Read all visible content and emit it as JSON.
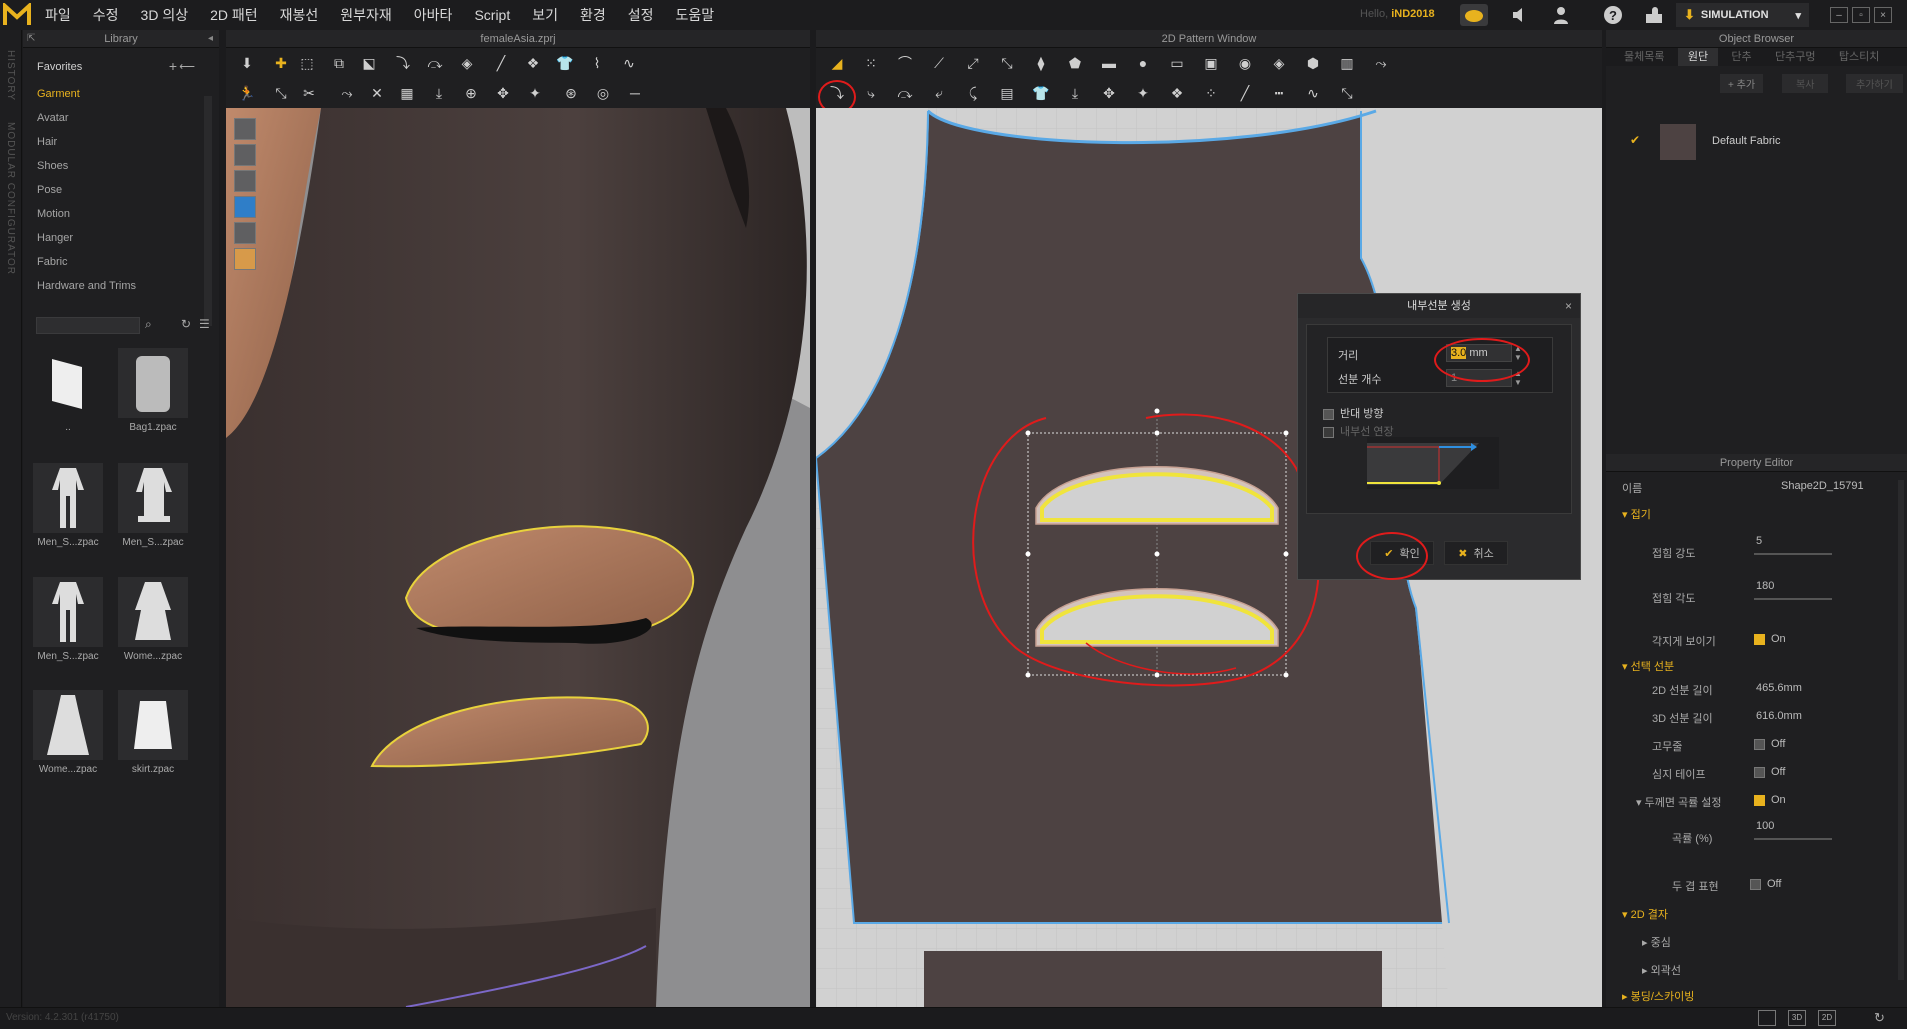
{
  "menu": {
    "items": [
      "파일",
      "수정",
      "3D 의상",
      "2D 패턴",
      "재봉선",
      "원부자재",
      "아바타",
      "Script",
      "보기",
      "환경",
      "설정",
      "도움말"
    ],
    "hello_prefix": "Hello,",
    "user": "iND2018",
    "simulation_label": "SIMULATION",
    "simulation_arrow": "▾"
  },
  "left_strip": {
    "history": "HISTORY",
    "modular": "MODULAR CONFIGURATOR"
  },
  "library": {
    "title": "Library",
    "favorites": "Favorites",
    "categories": [
      "Garment",
      "Avatar",
      "Hair",
      "Shoes",
      "Pose",
      "Motion",
      "Hanger",
      "Fabric",
      "Hardware and Trims"
    ],
    "active_category": "Garment",
    "thumbnails": [
      "..",
      "Bag1.zpac",
      "Men_S...zpac",
      "Men_S...zpac",
      "Men_S...zpac",
      "Wome...zpac",
      "Wome...zpac",
      "skirt.zpac"
    ]
  },
  "view3d": {
    "title": "femaleAsia.zprj"
  },
  "view2d": {
    "title": "2D Pattern Window"
  },
  "dialog": {
    "title": "내부선분 생성",
    "distance_label": "거리",
    "distance_value": "3.0",
    "distance_unit": "mm",
    "count_label": "선분 개수",
    "count_value": "1",
    "reverse_label": "반대 방향",
    "extend_label": "내부선 연장",
    "ok_label": "확인",
    "cancel_label": "취소"
  },
  "object_browser": {
    "title": "Object Browser",
    "tabs": [
      "물체목록",
      "원단",
      "단추",
      "단추구멍",
      "탑스티치"
    ],
    "active_tab": "원단",
    "add_label": "+ 추가",
    "copy_label": "복사",
    "add_fav_label": "추가하기",
    "fabric_name": "Default Fabric"
  },
  "property_editor": {
    "title": "Property Editor",
    "name_label": "이름",
    "name_value": "Shape2D_15791",
    "sections": {
      "fold": "접기",
      "selected_line": "선택 선분",
      "grain": "2D 결자",
      "elastic": "봉딩/스카이빙"
    },
    "fold_strength_label": "접힘 강도",
    "fold_strength_value": "5",
    "fold_angle_label": "접힘 각도",
    "fold_angle_value": "180",
    "show_sharp_label": "각지게 보이기",
    "show_sharp_value": "On",
    "len2d_label": "2D 선분 길이",
    "len2d_value": "465.6mm",
    "len3d_label": "3D 선분 길이",
    "len3d_value": "616.0mm",
    "rubber_label": "고무줄",
    "rubber_value": "Off",
    "tape_label": "심지 테이프",
    "tape_value": "Off",
    "thick_curve_label": "두께면 곡률 설정",
    "thick_curve_value": "On",
    "curve_label": "곡률 (%)",
    "curve_value": "100",
    "thick_render_label": "두 겹 표현",
    "thick_render_value": "Off",
    "center_label": "중심",
    "outline_label": "외곽선"
  },
  "status": {
    "version": "Version: 4.2.301 (r41750)"
  }
}
